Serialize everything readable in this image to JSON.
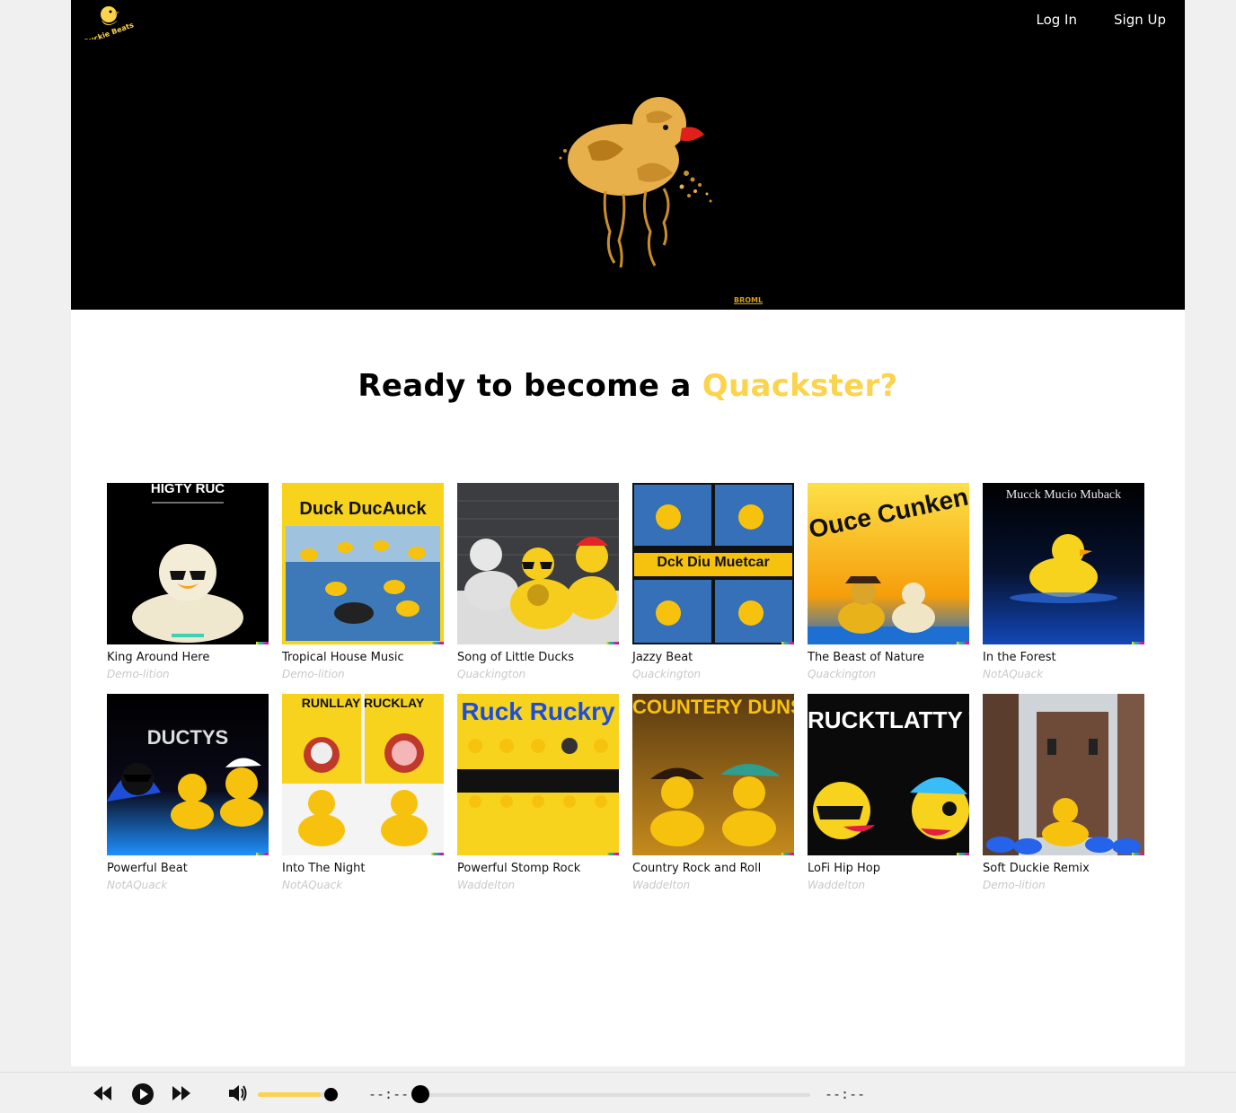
{
  "brand": {
    "name": "Duckie Beats"
  },
  "nav": {
    "login": "Log In",
    "signup": "Sign Up"
  },
  "hero": {
    "signature": "BROML"
  },
  "headline": {
    "lead": "Ready to become a ",
    "accent": "Quackster?"
  },
  "colors": {
    "accent": "#fcd34d",
    "hero_bg": "#000000",
    "artist_text": "#c8c8c8"
  },
  "songs": [
    {
      "title": "King Around Here",
      "artist": "Demo-lition",
      "cover_text": "HIGTY RUC"
    },
    {
      "title": "Tropical House Music",
      "artist": "Demo-lition",
      "cover_text": "Duck DucAuck"
    },
    {
      "title": "Song of Little Ducks",
      "artist": "Quackington",
      "cover_text": ""
    },
    {
      "title": "Jazzy Beat",
      "artist": "Quackington",
      "cover_text": "Dck Diu Muetcar"
    },
    {
      "title": "The Beast of Nature",
      "artist": "Quackington",
      "cover_text": "Ouce Cunkenty"
    },
    {
      "title": "In the Forest",
      "artist": "NotAQuack",
      "cover_text": "Mucck Mucio Muback"
    },
    {
      "title": "Powerful Beat",
      "artist": "NotAQuack",
      "cover_text": "DUCTYS"
    },
    {
      "title": "Into The Night",
      "artist": "NotAQuack",
      "cover_text": "RUNLLAY RUCKLAY"
    },
    {
      "title": "Powerful Stomp Rock",
      "artist": "Waddelton",
      "cover_text": "Ruck Ruckry"
    },
    {
      "title": "Country Rock and Roll",
      "artist": "Waddelton",
      "cover_text": "COUNTERY DUNSERY"
    },
    {
      "title": "LoFi Hip Hop",
      "artist": "Waddelton",
      "cover_text": "RUCKTLATTY THA UFK"
    },
    {
      "title": "Soft Duckie Remix",
      "artist": "Demo-lition",
      "cover_text": ""
    }
  ],
  "player": {
    "time_current": "--:--",
    "time_total": "--:--",
    "volume": 0.85,
    "progress": 0
  },
  "icons": {
    "rewind": "rewind-icon",
    "play": "play-icon",
    "forward": "fast-forward-icon",
    "volume": "volume-icon"
  }
}
